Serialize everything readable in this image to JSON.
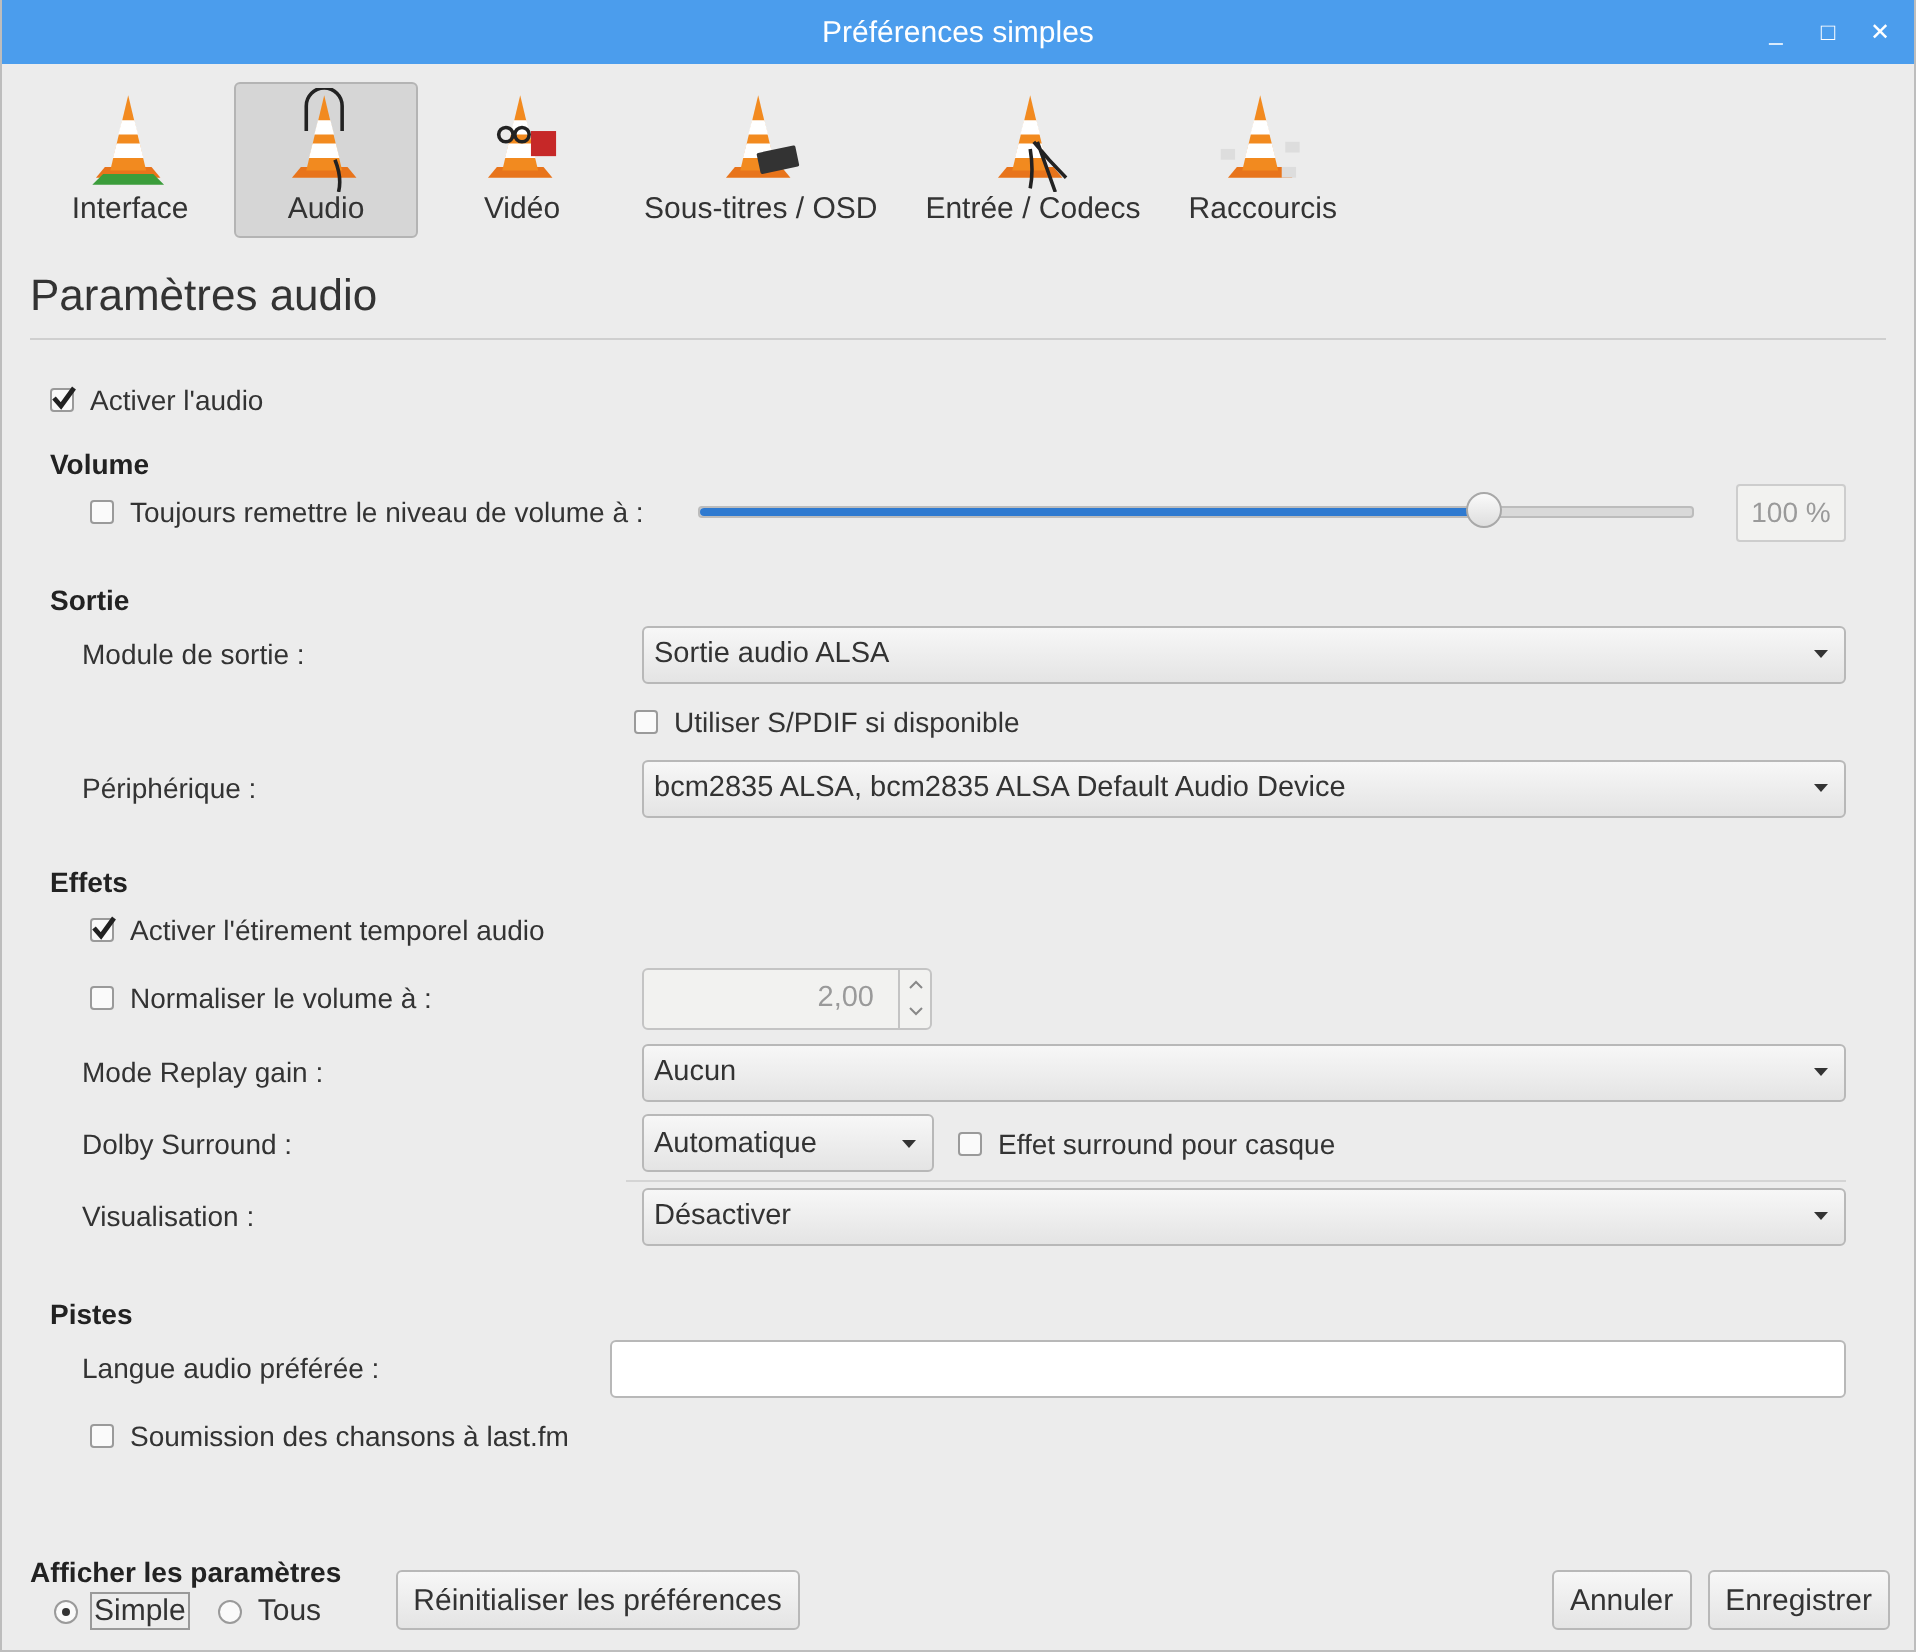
{
  "window": {
    "title": "Préférences simples",
    "controls": [
      "_",
      "□",
      "✕"
    ]
  },
  "tabs": [
    {
      "label": "Interface",
      "selected": false
    },
    {
      "label": "Audio",
      "selected": true
    },
    {
      "label": "Vidéo",
      "selected": false
    },
    {
      "label": "Sous-titres / OSD",
      "selected": false
    },
    {
      "label": "Entrée / Codecs",
      "selected": false
    },
    {
      "label": "Raccourcis",
      "selected": false
    }
  ],
  "heading": "Paramètres audio",
  "enable_audio": {
    "label": "Activer l'audio",
    "checked": true
  },
  "sections": [
    {
      "title": "Volume",
      "rows": [
        {
          "kind": "slider",
          "label": "Toujours remettre le niveau de volume à :",
          "checked": false,
          "level": 0.79,
          "value": "100 %",
          "disabled": true
        }
      ]
    },
    {
      "title": "Sortie",
      "rows": [
        {
          "kind": "combo",
          "label": "Module de sortie :",
          "value": "Sortie audio ALSA"
        },
        {
          "kind": "option",
          "label": "Utiliser S/PDIF si disponible",
          "checked": false
        },
        {
          "kind": "combo",
          "label": "Périphérique :",
          "value": "bcm2835 ALSA, bcm2835 ALSA Default Audio Device"
        }
      ]
    },
    {
      "title": "Effets",
      "rows": [
        {
          "kind": "checkbox",
          "label": "Activer l'étirement temporel audio",
          "checked": true
        },
        {
          "kind": "spin",
          "label": "Normaliser le volume à :",
          "checked": false,
          "value": "2,00",
          "disabled": true
        },
        {
          "kind": "combo",
          "label": "Mode Replay gain :",
          "value": "Aucun"
        },
        {
          "kind": "combo-check",
          "label": "Dolby Surround :",
          "value": "Automatique",
          "check_label": "Effet surround pour casque",
          "checked": false
        },
        {
          "kind": "separator"
        },
        {
          "kind": "combo",
          "label": "Visualisation :",
          "value": "Désactiver"
        }
      ]
    },
    {
      "title": "Pistes",
      "rows": [
        {
          "kind": "text",
          "label": "Langue audio préférée :"
        },
        {
          "kind": "checkbox",
          "label": "Soumission des chansons à last.fm",
          "checked": false
        }
      ]
    }
  ],
  "footer": {
    "title": "Afficher les paramètres",
    "modes": [
      {
        "label": "Simple",
        "selected": true
      },
      {
        "label": "Tous",
        "selected": false
      }
    ],
    "reset": "Réinitialiser les préférences",
    "buttons": [
      "Annuler",
      "Enregistrer"
    ]
  }
}
